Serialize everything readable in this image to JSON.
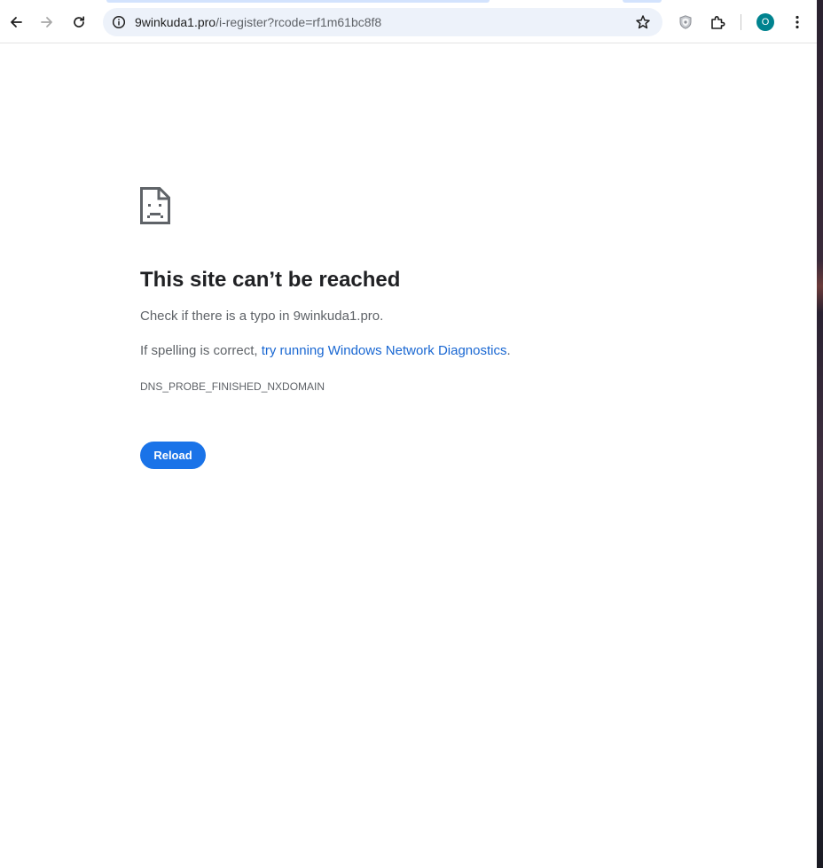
{
  "toolbar": {
    "back_icon": "arrow-left-icon",
    "forward_icon": "arrow-right-icon",
    "reload_icon": "reload-icon",
    "site_info_icon": "info-circle-icon",
    "url_host": "9winkuda1.pro",
    "url_path": "/i-register?rcode=rf1m61bc8f8",
    "bookmark_icon": "star-icon",
    "shield_extension_icon": "shield-icon",
    "extensions_icon": "puzzle-icon",
    "profile_initial": "O",
    "menu_icon": "kebab-menu-icon"
  },
  "error_page": {
    "icon": "sad-page-icon",
    "title": "This site can’t be reached",
    "line1": "Check if there is a typo in 9winkuda1.pro.",
    "line2_prefix": "If spelling is correct, ",
    "line2_link": "try running Windows Network Diagnostics",
    "line2_suffix": ".",
    "error_code": "DNS_PROBE_FINISHED_NXDOMAIN",
    "reload_label": "Reload"
  },
  "colors": {
    "accent": "#1a73e8",
    "link": "#1967d2",
    "omnibox_bg": "#edf2fa",
    "avatar_bg": "#00838f"
  }
}
